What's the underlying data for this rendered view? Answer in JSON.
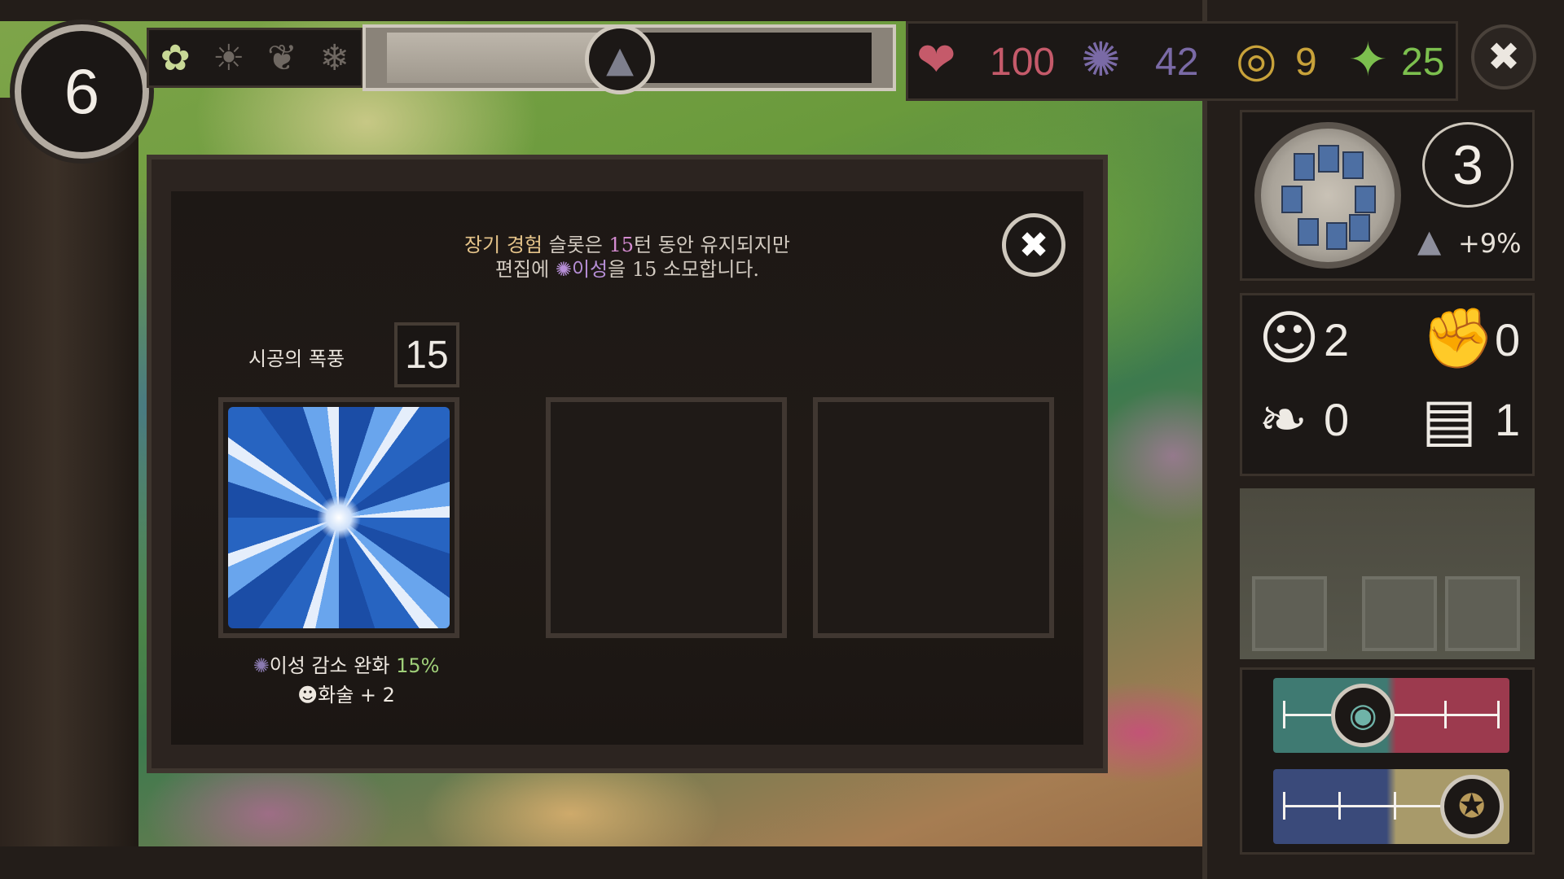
{
  "top": {
    "day": "6",
    "seasons": [
      {
        "name": "spring",
        "icon": "✿",
        "active": true
      },
      {
        "name": "summer",
        "icon": "☀",
        "active": false
      },
      {
        "name": "autumn",
        "icon": "❦",
        "active": false
      },
      {
        "name": "winter",
        "icon": "❄",
        "active": false
      }
    ],
    "progress": 0.45,
    "hood_icon": "hood-icon",
    "stats": [
      {
        "key": "health",
        "icon": "❤",
        "icon_name": "heart-icon",
        "value": "100",
        "color": "#c55a6a"
      },
      {
        "key": "sanity",
        "icon": "✺",
        "icon_name": "brain-icon",
        "value": "42",
        "color": "#7a6aa6"
      },
      {
        "key": "gold",
        "icon": "◎",
        "icon_name": "ring-icon",
        "value": "9",
        "color": "#c8a23a"
      },
      {
        "key": "food",
        "icon": "✦",
        "icon_name": "leaf-icon",
        "value": "25",
        "color": "#7cbf4e"
      }
    ],
    "close_icon": "✖"
  },
  "right_panel": {
    "level": "3",
    "bonus": "+9%",
    "skills": [
      {
        "key": "speech",
        "icon": "☺",
        "icon_name": "speaking-head-icon",
        "value": "2"
      },
      {
        "key": "strength",
        "icon": "✊",
        "icon_name": "fist-icon",
        "value": "0"
      },
      {
        "key": "nature",
        "icon": "❧",
        "icon_name": "feather-icon",
        "value": "0"
      },
      {
        "key": "knowledge",
        "icon": "▤",
        "icon_name": "book-icon",
        "value": "1"
      }
    ],
    "tracks": [
      {
        "left_color": "#3f7a72",
        "right_color": "#9c3a4e",
        "knob_icon": "◉",
        "knob_pos": 0.38
      },
      {
        "left_color": "#3a4a7a",
        "right_color": "#a89a6a",
        "knob_icon": "✪",
        "knob_pos": 0.84
      }
    ]
  },
  "dialog": {
    "desc_line1": {
      "a": "장기 경험",
      "b": " 슬롯은 ",
      "c": "15",
      "d": "턴 동안 유지되지만"
    },
    "desc_line2": {
      "a": "편집에 ",
      "b": "이성",
      "c": "을  15 소모합니다."
    },
    "slot_label": "시공의 폭풍",
    "slot_count": "15",
    "effect_1": {
      "prefix": "이성 감소 완화 ",
      "value": "15%"
    },
    "effect_2": "화술 + 2",
    "close_icon": "✖"
  }
}
